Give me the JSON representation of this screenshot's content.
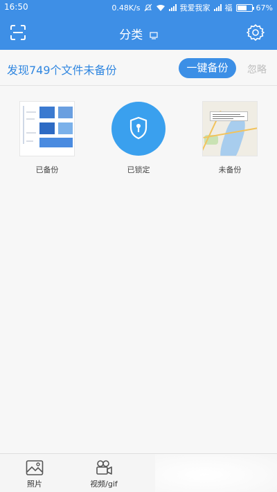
{
  "status_bar": {
    "time": "16:50",
    "speed": "0.48K/s",
    "carrier1": "我爱我家",
    "carrier2": "福",
    "battery": "67%",
    "battery_level": 0.67
  },
  "app_bar": {
    "title": "分类",
    "icons": [
      "scan-icon",
      "device-icon",
      "gear-icon"
    ]
  },
  "banner": {
    "message": "发现749个文件未备份",
    "backup_button": "一键备份",
    "ignore": "忽略"
  },
  "categories": [
    {
      "label": "已备份",
      "icon": "document-thumbnail"
    },
    {
      "label": "已锁定",
      "icon": "shield-icon"
    },
    {
      "label": "未备份",
      "icon": "map-thumbnail"
    }
  ],
  "bottom_nav": [
    {
      "label": "照片",
      "icon": "photo-icon"
    },
    {
      "label": "视频/gif",
      "icon": "video-camera-icon"
    },
    {
      "label": "",
      "icon": "tab-3-icon"
    },
    {
      "label": "",
      "icon": "tab-4-icon"
    }
  ],
  "colors": {
    "primary": "#3e8fe6",
    "banner_text": "#2f86e0",
    "lock_circle": "#3aa0ee"
  }
}
